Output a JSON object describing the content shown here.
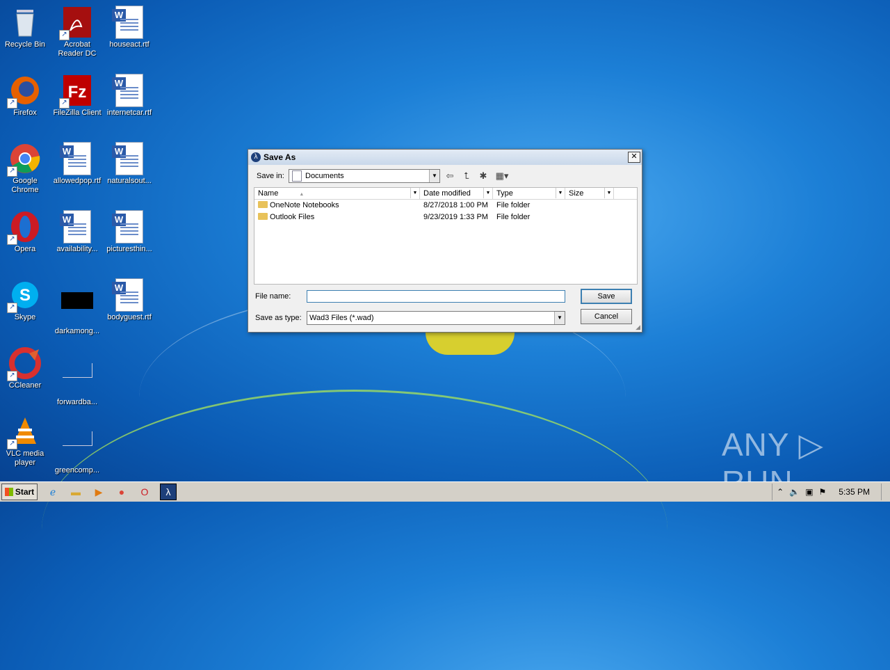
{
  "desktop": {
    "icons": [
      {
        "label": "Recycle Bin",
        "icon": "recycle-bin-icon"
      },
      {
        "label": "Acrobat Reader DC",
        "icon": "acrobat-icon"
      },
      {
        "label": "houseact.rtf",
        "icon": "word-doc-icon"
      },
      {
        "label": "Firefox",
        "icon": "firefox-icon"
      },
      {
        "label": "FileZilla Client",
        "icon": "filezilla-icon"
      },
      {
        "label": "internetcar.rtf",
        "icon": "word-doc-icon"
      },
      {
        "label": "Google Chrome",
        "icon": "chrome-icon"
      },
      {
        "label": "allowedpop.rtf",
        "icon": "word-doc-icon"
      },
      {
        "label": "naturalsout...",
        "icon": "word-doc-icon"
      },
      {
        "label": "Opera",
        "icon": "opera-icon"
      },
      {
        "label": "availability...",
        "icon": "word-doc-icon"
      },
      {
        "label": "picturesthin...",
        "icon": "word-doc-icon"
      },
      {
        "label": "Skype",
        "icon": "skype-icon"
      },
      {
        "label": "darkamong...",
        "icon": "black-image-icon"
      },
      {
        "label": "bodyguest.rtf",
        "icon": "word-doc-icon"
      },
      {
        "label": "CCleaner",
        "icon": "ccleaner-icon"
      },
      {
        "label": "forwardba...",
        "icon": "blank-file-icon"
      },
      {
        "label": "VLC media player",
        "icon": "vlc-icon"
      },
      {
        "label": "greencomp...",
        "icon": "blank-file-icon"
      }
    ]
  },
  "dialog": {
    "title": "Save As",
    "close_glyph": "✕",
    "save_in_label": "Save in:",
    "save_in_value": "Documents",
    "columns": [
      "Name",
      "Date modified",
      "Type",
      "Size"
    ],
    "files": [
      {
        "name": "OneNote Notebooks",
        "date": "8/27/2018 1:00 PM",
        "type": "File folder",
        "size": ""
      },
      {
        "name": "Outlook Files",
        "date": "9/23/2019 1:33 PM",
        "type": "File folder",
        "size": ""
      }
    ],
    "file_name_label": "File name:",
    "file_name_value": "",
    "save_as_type_label": "Save as type:",
    "save_as_type_value": "Wad3 Files (*.wad)",
    "save_button": "Save",
    "cancel_button": "Cancel"
  },
  "taskbar": {
    "start_label": "Start",
    "clock": "5:35 PM"
  },
  "watermark": "ANY ▷ RUN"
}
